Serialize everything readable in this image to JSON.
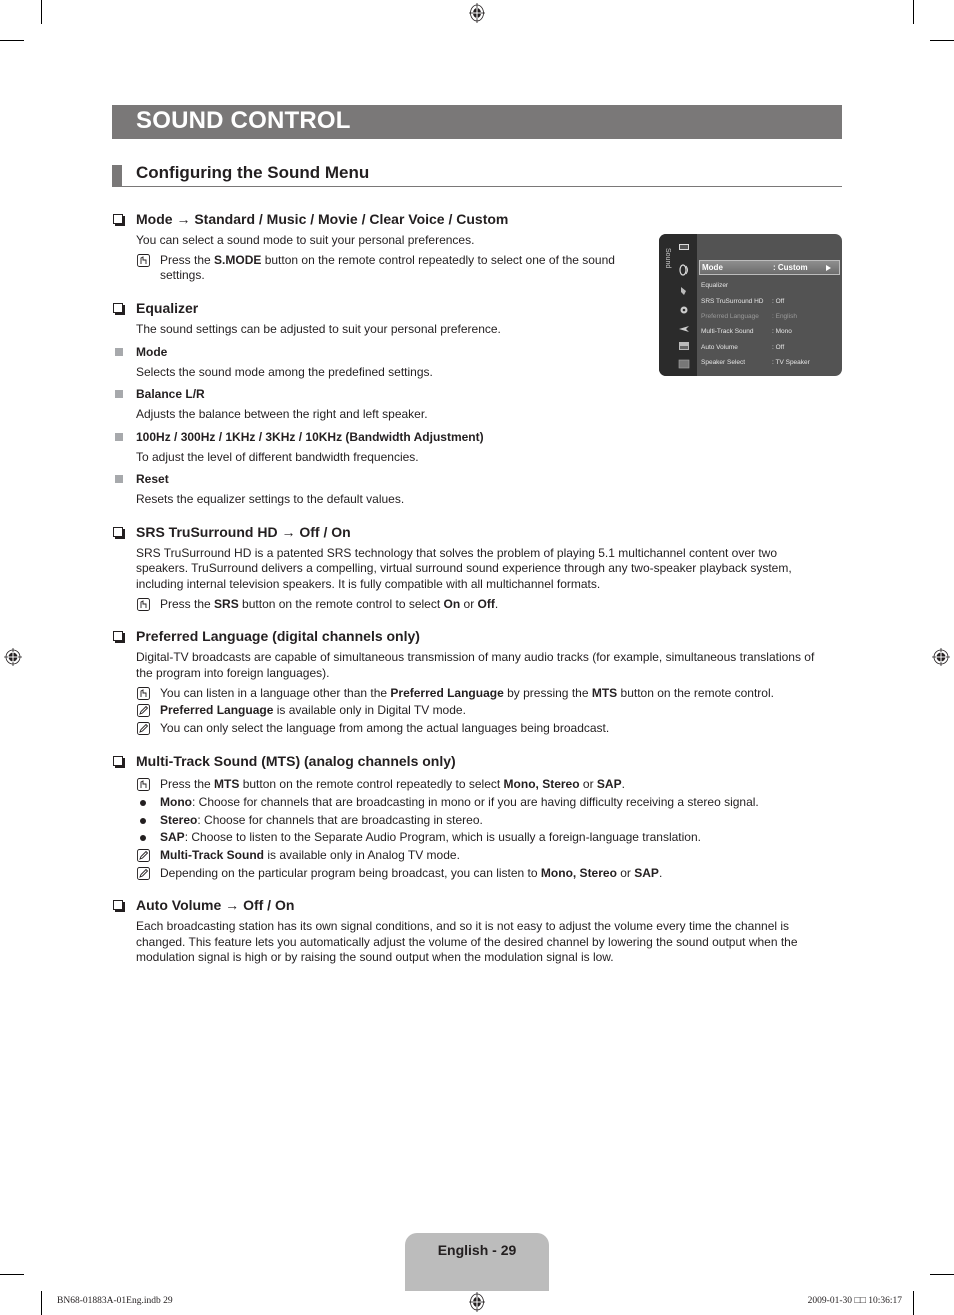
{
  "page": {
    "title": "SOUND CONTROL",
    "section_heading": "Configuring the Sound Menu",
    "page_label": "English - 29",
    "footer_left": "BN68-01883A-01Eng.indb   29",
    "footer_right": "2009-01-30   □□ 10:36:17"
  },
  "tv_menu": {
    "side_label": "Sound",
    "side_icons": [
      "picture-icon",
      "sound-icon",
      "channel-icon",
      "setup-icon",
      "input-icon",
      "application-icon",
      "support-icon"
    ],
    "rows": [
      {
        "label": "Mode",
        "value": ": Custom",
        "selected": true
      },
      {
        "label": "Equalizer",
        "value": ""
      },
      {
        "label": "SRS TruSurround HD",
        "value": ": Off"
      },
      {
        "label": "Preferred Language",
        "value": ": English",
        "dimmed": true
      },
      {
        "label": "Multi-Track Sound",
        "value": ": Mono"
      },
      {
        "label": "Auto Volume",
        "value": ": Off"
      },
      {
        "label": "Speaker Select",
        "value": ": TV Speaker"
      }
    ]
  },
  "mode": {
    "heading": "Mode → Standard / Music / Movie / Clear Voice / Custom",
    "body": "You can select a sound mode to suit your personal preferences.",
    "note_pre": "Press the ",
    "note_bold": "S.MODE",
    "note_post": " button on the remote control repeatedly to select one of the sound",
    "note_line2": "settings."
  },
  "equalizer": {
    "heading": "Equalizer",
    "body": "The sound settings can be adjusted to suit your personal preference.",
    "items": [
      {
        "title": "Mode",
        "desc": "Selects the sound mode among the predefined settings."
      },
      {
        "title": "Balance L/R",
        "desc": "Adjusts the balance between the right and left speaker."
      },
      {
        "title": "100Hz / 300Hz / 1KHz / 3KHz / 10KHz (Bandwidth Adjustment)",
        "desc": "To adjust the level of different bandwidth frequencies."
      },
      {
        "title": "Reset",
        "desc": "Resets the equalizer settings to the default values."
      }
    ]
  },
  "srs": {
    "heading": "SRS TruSurround HD → Off / On",
    "body_lines": [
      "SRS TruSurround HD is a patented SRS technology that solves the problem of playing 5.1 multichannel content over two",
      "speakers. TruSurround delivers a compelling, virtual surround sound experience through any two-speaker playback system,",
      "including internal television speakers. It is fully compatible with all multichannel formats."
    ],
    "note": {
      "a": "Press the ",
      "b1": "SRS",
      "c": " button on the remote control to select ",
      "b2": "On",
      "d": " or ",
      "b3": "Off",
      "e": "."
    }
  },
  "preferred_language": {
    "heading": "Preferred Language (digital channels only)",
    "body_lines": [
      "Digital-TV broadcasts are capable of simultaneous transmission of many audio tracks (for example, simultaneous translations of",
      "the program into foreign languages)."
    ],
    "note1": {
      "a": "You can listen in a language other than the ",
      "b1": "Preferred Language",
      "c": " by pressing the ",
      "b2": "MTS",
      "d": " button on the remote control."
    },
    "note2": {
      "b1": "Preferred Language",
      "a": " is available only in Digital TV mode."
    },
    "note3": "You can only select the language from among the actual languages being broadcast."
  },
  "mts": {
    "heading": "Multi-Track Sound (MTS) (analog channels only)",
    "note1": {
      "a": "Press the ",
      "b1": "MTS",
      "c": " button on the remote control repeatedly to select ",
      "b2": "Mono, Stereo",
      "d": " or ",
      "b3": "SAP",
      "e": "."
    },
    "bullets": [
      {
        "bold": "Mono",
        "text": ": Choose for channels that are broadcasting in mono or if you are having difficulty receiving a stereo signal."
      },
      {
        "bold": "Stereo",
        "text": ": Choose for channels that are broadcasting in stereo."
      },
      {
        "bold": "SAP",
        "text": ": Choose to listen to the Separate Audio Program, which is usually a foreign-language translation."
      }
    ],
    "note2": {
      "b1": "Multi-Track Sound",
      "a": " is available only in Analog TV mode."
    },
    "note3": {
      "a": "Depending on the particular program being broadcast, you can listen to ",
      "b1": "Mono, Stereo",
      "c": " or ",
      "b2": "SAP",
      "d": "."
    }
  },
  "auto_volume": {
    "heading": "Auto Volume → Off / On",
    "body_lines": [
      "Each broadcasting station has its own signal conditions, and so it is not easy to adjust the volume every time the channel is",
      "changed. This feature lets you automatically adjust the volume of the desired channel by lowering the sound output when the",
      "modulation signal is high or by raising the sound output when the modulation signal is low."
    ]
  }
}
